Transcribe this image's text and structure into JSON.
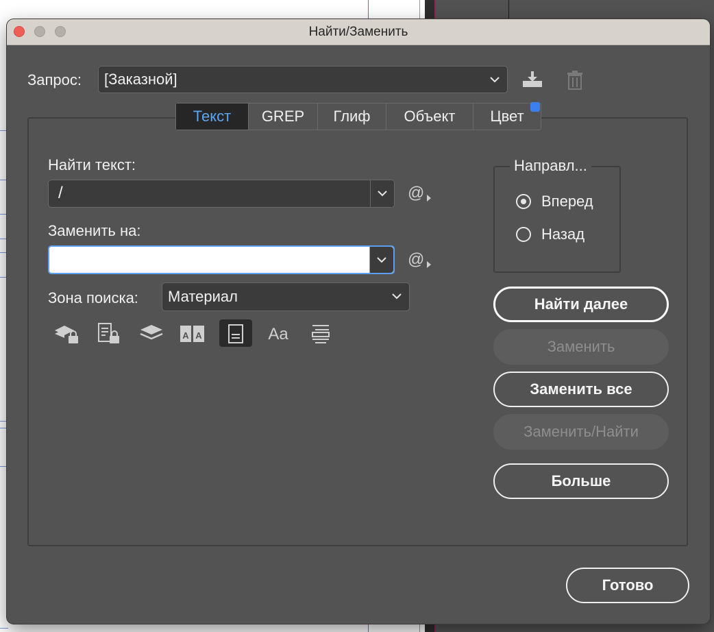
{
  "window": {
    "title": "Найти/Заменить"
  },
  "query": {
    "label": "Запрос:",
    "value": "[Заказной]",
    "save_icon": "save-query-icon",
    "delete_icon": "trash-icon"
  },
  "tabs": [
    {
      "label": "Текст",
      "active": true
    },
    {
      "label": "GREP",
      "active": false
    },
    {
      "label": "Глиф",
      "active": false
    },
    {
      "label": "Объект",
      "active": false
    },
    {
      "label": "Цвет",
      "active": false
    }
  ],
  "find": {
    "label": "Найти текст:",
    "value": "/"
  },
  "replace": {
    "label": "Заменить на:",
    "value": ""
  },
  "search_zone": {
    "label": "Зона поиска:",
    "value": "Материал"
  },
  "options_icons": [
    "locked-layers-icon",
    "locked-stories-icon",
    "hidden-layers-icon",
    "master-pages-icon",
    "footnotes-icon",
    "case-sensitive-icon",
    "whole-word-icon"
  ],
  "direction": {
    "legend": "Направл...",
    "forward": "Вперед",
    "backward": "Назад",
    "selected": "forward"
  },
  "buttons": {
    "find_next": "Найти далее",
    "replace": "Заменить",
    "replace_all": "Заменить все",
    "replace_find": "Заменить/Найти",
    "more": "Больше",
    "done": "Готово"
  },
  "colors": {
    "dialog_bg": "#535353",
    "active_tab_text": "#5ca7f2",
    "focus_border": "#5d9ff3",
    "close_button": "#ee5f57"
  }
}
